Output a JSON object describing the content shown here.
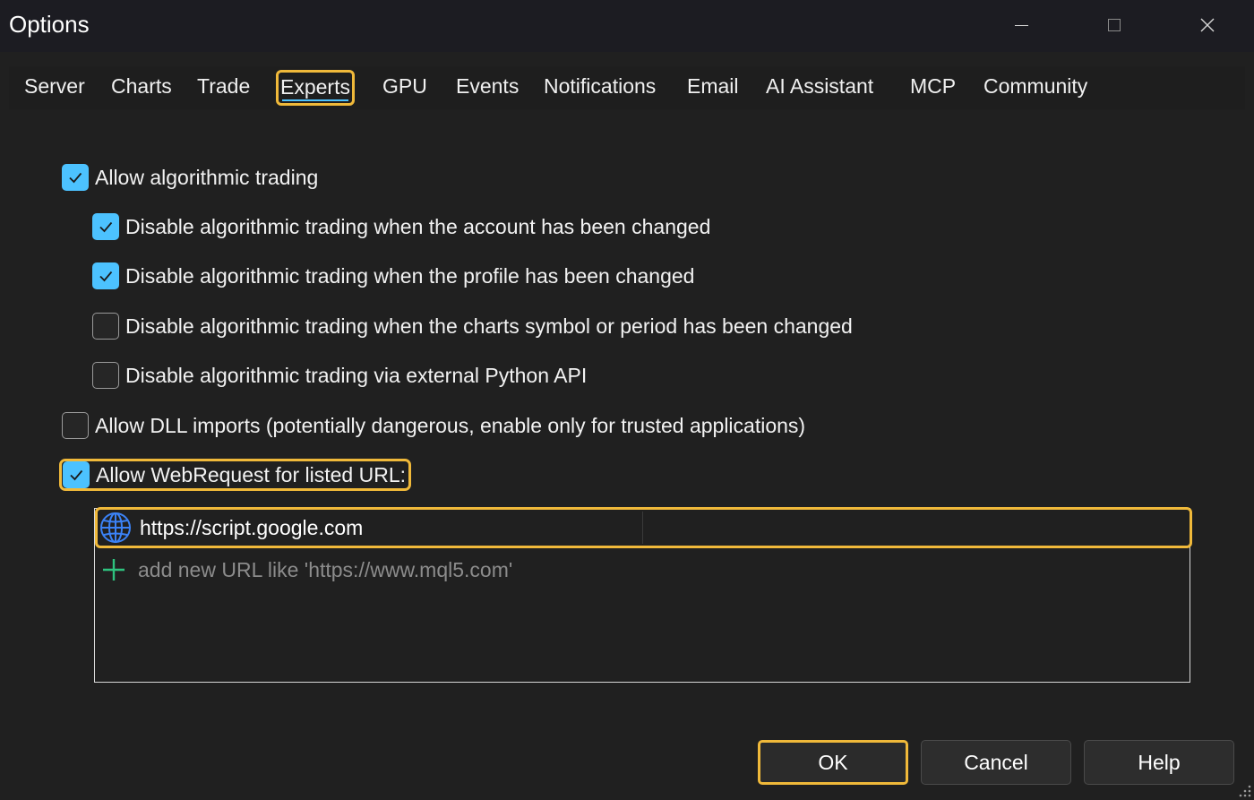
{
  "window": {
    "title": "Options"
  },
  "tabs": [
    {
      "label": "Server"
    },
    {
      "label": "Charts"
    },
    {
      "label": "Trade"
    },
    {
      "label": "Experts",
      "active": true
    },
    {
      "label": "GPU"
    },
    {
      "label": "Events"
    },
    {
      "label": "Notifications"
    },
    {
      "label": "Email"
    },
    {
      "label": "AI Assistant"
    },
    {
      "label": "MCP"
    },
    {
      "label": "Community"
    }
  ],
  "experts": {
    "allow_algo_trading": {
      "label": "Allow algorithmic trading",
      "checked": true
    },
    "disable_on_account_change": {
      "label": "Disable algorithmic trading when the account has been changed",
      "checked": true
    },
    "disable_on_profile_change": {
      "label": "Disable algorithmic trading when the profile has been changed",
      "checked": true
    },
    "disable_on_symbol_change": {
      "label": "Disable algorithmic trading when the charts symbol or period has been changed",
      "checked": false
    },
    "disable_python_api": {
      "label": "Disable algorithmic trading via external Python API",
      "checked": false
    },
    "allow_dll": {
      "label": "Allow DLL imports (potentially dangerous, enable only for trusted applications)",
      "checked": false
    },
    "allow_webrequest": {
      "label": "Allow WebRequest for listed URL:",
      "checked": true
    }
  },
  "url_list": {
    "urls": [
      "https://script.google.com"
    ],
    "add_placeholder": "add new URL like 'https://www.mql5.com'"
  },
  "buttons": {
    "ok": "OK",
    "cancel": "Cancel",
    "help": "Help"
  },
  "colors": {
    "accent": "#4cc2ff",
    "highlight": "#f0b93a",
    "add_icon": "#2ec27e",
    "globe_icon": "#3b82f6"
  },
  "icons": {
    "globe": "globe-icon",
    "add": "plus-icon",
    "check": "checkmark-icon"
  }
}
